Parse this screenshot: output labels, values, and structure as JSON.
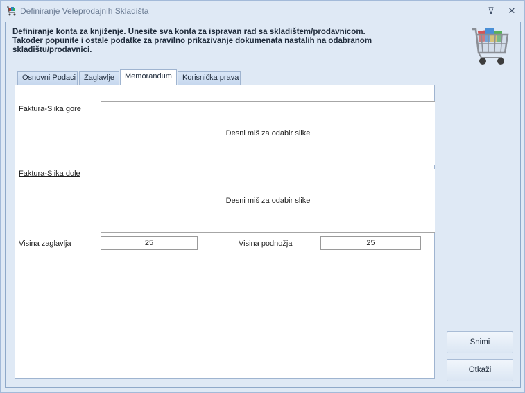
{
  "window": {
    "title": "Definiranje Veleprodajnih Skladišta",
    "pin_glyph": "⊽",
    "close_glyph": "✕"
  },
  "header": {
    "line1": "Definiranje konta za knjiženje. Unesite sva konta za ispravan rad sa skladištem/prodavnicom.",
    "line2": "Također popunite i ostale podatke za pravilno prikazivanje dokumenata nastalih na odabranom",
    "line3": "skladištu/prodavnici."
  },
  "tabs": [
    {
      "label": "Osnovni Podaci",
      "active": false
    },
    {
      "label": "Zaglavlje",
      "active": false
    },
    {
      "label": "Memorandum",
      "active": true
    },
    {
      "label": "Korisnička prava",
      "active": false
    }
  ],
  "memorandum": {
    "header_image_label": "Faktura-Slika gore",
    "header_image_hint": "Desni miš za odabir slike",
    "footer_image_label": "Faktura-Slika dole",
    "footer_image_hint": "Desni miš za odabir slike",
    "header_height_label": "Visina zaglavlja",
    "header_height_value": "25",
    "footer_height_label": "Visina podnožja",
    "footer_height_value": "25"
  },
  "buttons": {
    "save": "Snimi",
    "cancel": "Otkaži"
  },
  "icons": {
    "app": "shopping-cart-icon",
    "header": "shopping-cart-icon"
  }
}
